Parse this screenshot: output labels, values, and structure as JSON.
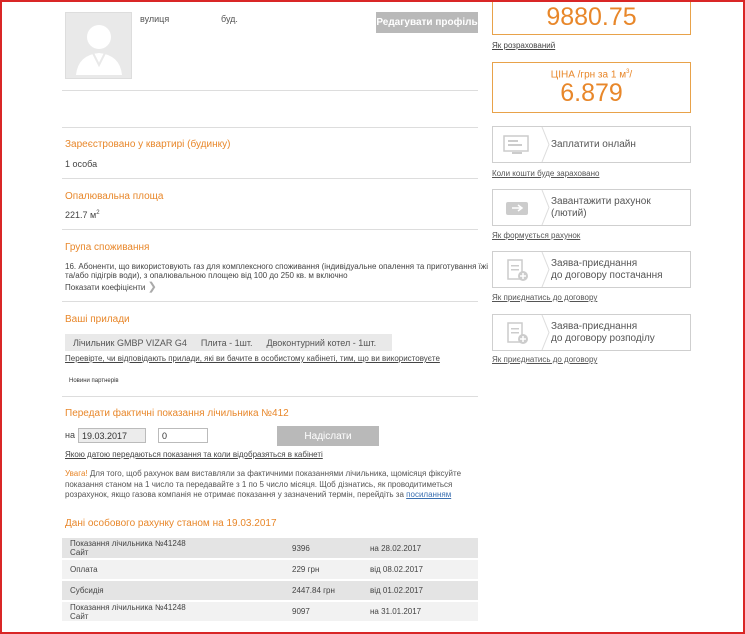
{
  "profile": {
    "street_label": "вулиця",
    "building_label": "буд.",
    "edit_button": "Редагувати профіль"
  },
  "price": {
    "total": "9880.75",
    "how_calculated": "Як розрахований",
    "price_label": "ЦІНА /грн за 1 м",
    "price_superscript": "3",
    "price_suffix": "/",
    "price_value": "6.879"
  },
  "registered": {
    "title": "Зареєстровано у квартирі (будинку)",
    "value": "1 особа"
  },
  "heated_area": {
    "title": "Опалювальна площа",
    "value": "221.7 м",
    "unit_sup": "2"
  },
  "consumption_group": {
    "title": "Група споживання",
    "line1": "16. Абоненти, що використовують газ для комплексного споживання (індивідуальне опалення та приготування їжі",
    "line2": "та/або підігрів води), з опалювальною площею від 100 до 250 кв. м включно",
    "show_coefficients": "Показати коефіцієнти"
  },
  "devices": {
    "title": "Ваші прилади",
    "items": [
      "Лічильник GMBP VIZAR G4",
      "Плита - 1шт.",
      "Двоконтурний котел - 1шт."
    ],
    "check_link": "Перевірте, чи відповідають прилади, які ви бачите в особистому кабінеті, тим, що ви використовуєте",
    "partners_news": "Новини партнерів"
  },
  "meter_reading": {
    "title": "Передати фактичні показання лічильника №412",
    "on_label": "на",
    "date_value": "19.03.2017",
    "reading_value": "0",
    "send_button": "Надіслати",
    "date_link": "Якою датою передаються показання та коли відобразяться в кабінеті",
    "warning_prefix": "Увага!",
    "warning_line1": " Для того, щоб рахунок вам виставляли за фактичними показаннями лічильника, щомісяця фіксуйте",
    "warning_line2": "показання станом на 1 число та передавайте з 1 по 5 число місяця. Щоб дізнатись, як проводитиметься",
    "warning_line3": "розрахунок, якщо газова компанія не отримає показання у зазначений термін, перейдіть за ",
    "warning_link": "посиланням"
  },
  "account": {
    "title": "Дані особового рахунку станом на 19.03.2017",
    "rows": [
      {
        "name1": "Показання лічильника №41248",
        "name2": "Сайт",
        "value": "9396",
        "date": "на 28.02.2017"
      },
      {
        "name1": "Оплата",
        "name2": "",
        "value": "229 грн",
        "date": "від 08.02.2017"
      },
      {
        "name1": "Субсидія",
        "name2": "",
        "value": "2447.84 грн",
        "date": "від 01.02.2017"
      },
      {
        "name1": "Показання лічильника №41248",
        "name2": "Сайт",
        "value": "9097",
        "date": "на 31.01.2017"
      }
    ]
  },
  "actions": {
    "pay_online": "Заплатити онлайн",
    "pay_link": "Коли кошти буде зараховано",
    "download_bill_1": "Завантажити рахунок",
    "download_bill_2": "(лютий)",
    "bill_link": "Як формується рахунок",
    "supply_1": "Заява-приєднання",
    "supply_2": "до договору постачання",
    "supply_link": "Як приєднатись до договору",
    "distrib_1": "Заява-приєднання",
    "distrib_2": "до договору розподілу",
    "distrib_link": "Як приєднатись до договору"
  },
  "colors": {
    "accent": "#e8872a",
    "frame": "#d92626",
    "button": "#b9b9b9"
  }
}
